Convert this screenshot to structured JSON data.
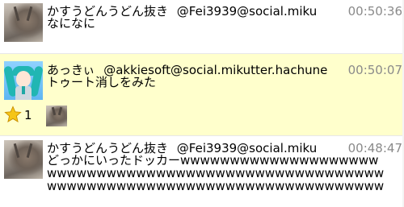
{
  "posts": [
    {
      "display_name": "かすうどんうどん抜き",
      "handle": "@Fei3939@social.miku",
      "time": "00:50:36",
      "text": "なになに",
      "avatar": "deer-avatar-icon"
    },
    {
      "display_name": "あっきぃ",
      "handle": "@akkiesoft@social.mikutter.hachune",
      "time": "00:50:07",
      "text": "トゥート消しをみた",
      "avatar": "miku-avatar-icon",
      "favorites": {
        "count": "1",
        "icon": "star-icon"
      }
    },
    {
      "display_name": "かすうどんうどん抜き",
      "handle": "@Fei3939@social.miku",
      "time": "00:48:47",
      "text": "どっかにいったドッカーwwwwwwwwwwwwwwwwwwwwwwwwwwwwwwwwwwwwwwwwwwwwwwwwwwwwwwwwwwwwwwwwwwwwwwwwwwwwwwwwwwwwwwwwww",
      "avatar": "deer-avatar-icon"
    }
  ],
  "colors": {
    "highlight_background": "#ffffcc",
    "timestamp": "#8a8a8a",
    "star": "#f5c518"
  }
}
